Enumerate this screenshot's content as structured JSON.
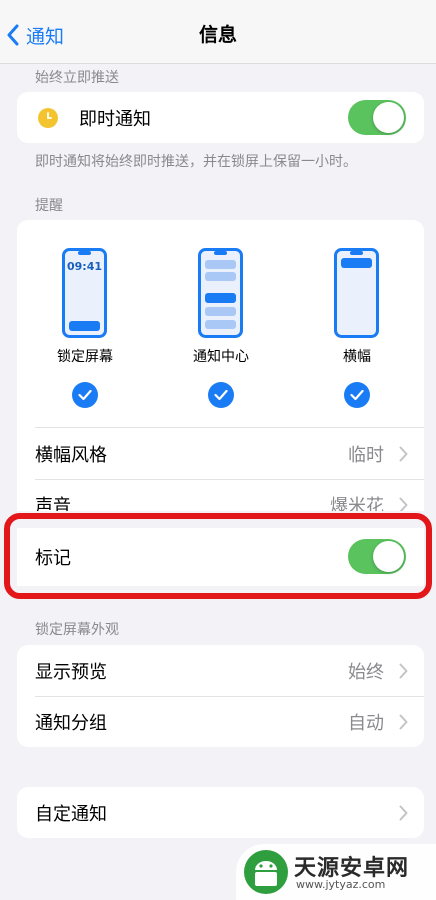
{
  "nav": {
    "back_label": "通知",
    "title": "信息"
  },
  "always_immediate": {
    "header": "始终立即推送",
    "row_label": "即时通知",
    "toggle_on": true,
    "footnote": "即时通知将始终即时推送，并在锁屏上保留一小时。"
  },
  "alerts": {
    "header": "提醒",
    "phone_time": "09:41",
    "options": [
      {
        "label": "锁定屏幕",
        "checked": true
      },
      {
        "label": "通知中心",
        "checked": true
      },
      {
        "label": "横幅",
        "checked": true
      }
    ],
    "banner_style": {
      "label": "横幅风格",
      "value": "临时"
    },
    "sounds": {
      "label": "声音",
      "value": "爆米花"
    },
    "badges": {
      "label": "标记",
      "toggle_on": true
    }
  },
  "lock_screen": {
    "header": "锁定屏幕外观",
    "show_previews": {
      "label": "显示预览",
      "value": "始终"
    },
    "grouping": {
      "label": "通知分组",
      "value": "自动"
    }
  },
  "custom": {
    "label": "自定通知"
  },
  "watermark": {
    "name": "天源安卓网",
    "url": "www.jytyaz.com"
  },
  "colors": {
    "accent": "#1a7cf5",
    "toggle_on": "#5ac35e",
    "highlight": "#e3161a"
  }
}
